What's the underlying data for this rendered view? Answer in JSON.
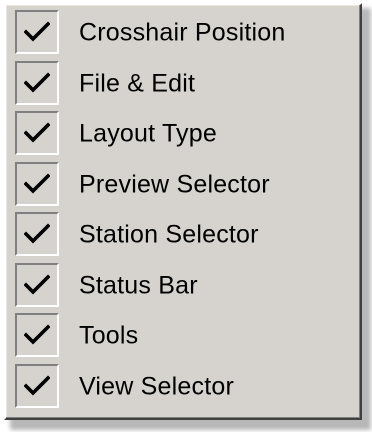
{
  "menu": {
    "items": [
      {
        "label": "Crosshair Position",
        "checked": true
      },
      {
        "label": "File & Edit",
        "checked": true
      },
      {
        "label": "Layout Type",
        "checked": true
      },
      {
        "label": "Preview Selector",
        "checked": true
      },
      {
        "label": "Station Selector",
        "checked": true
      },
      {
        "label": "Status Bar",
        "checked": true
      },
      {
        "label": "Tools",
        "checked": true
      },
      {
        "label": "View Selector",
        "checked": true
      }
    ]
  },
  "colors": {
    "menu_background": "#d6d3ce",
    "text": "#000000",
    "check": "#000000"
  },
  "icons": {
    "check": "checkmark-icon"
  }
}
